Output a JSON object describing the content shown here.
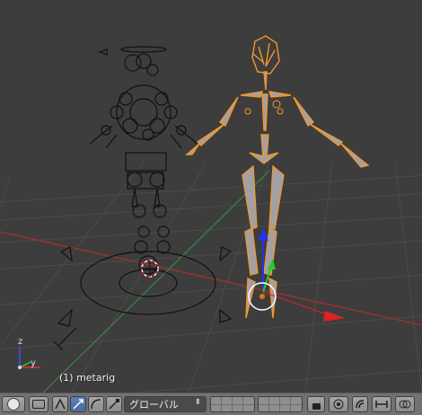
{
  "viewport": {
    "object_label": "(1) metarig",
    "axis_labels": {
      "z": "z",
      "y": "y"
    }
  },
  "toolbar": {
    "orientation": {
      "value": "グローバル"
    },
    "icons": [
      "shading-mode-icon",
      "view-toggle-icon",
      "pivot-icon",
      "manipulator-translate-icon",
      "manipulator-rotate-icon",
      "manipulator-scale-icon",
      "layers-icon",
      "lock-icon",
      "proportional-edit-icon",
      "snap-icon",
      "onion-skin-icon"
    ]
  },
  "colors": {
    "background": "#3d3d3d",
    "grid": "#4a4a4a",
    "x_axis": "#b03030",
    "y_axis": "#3a8a3a",
    "selected_bone": "#f0982c",
    "bone_fill": "#a0a0a8",
    "widget_blue": "#2233ee",
    "widget_green": "#22cc22",
    "widget_red": "#dd2222"
  }
}
